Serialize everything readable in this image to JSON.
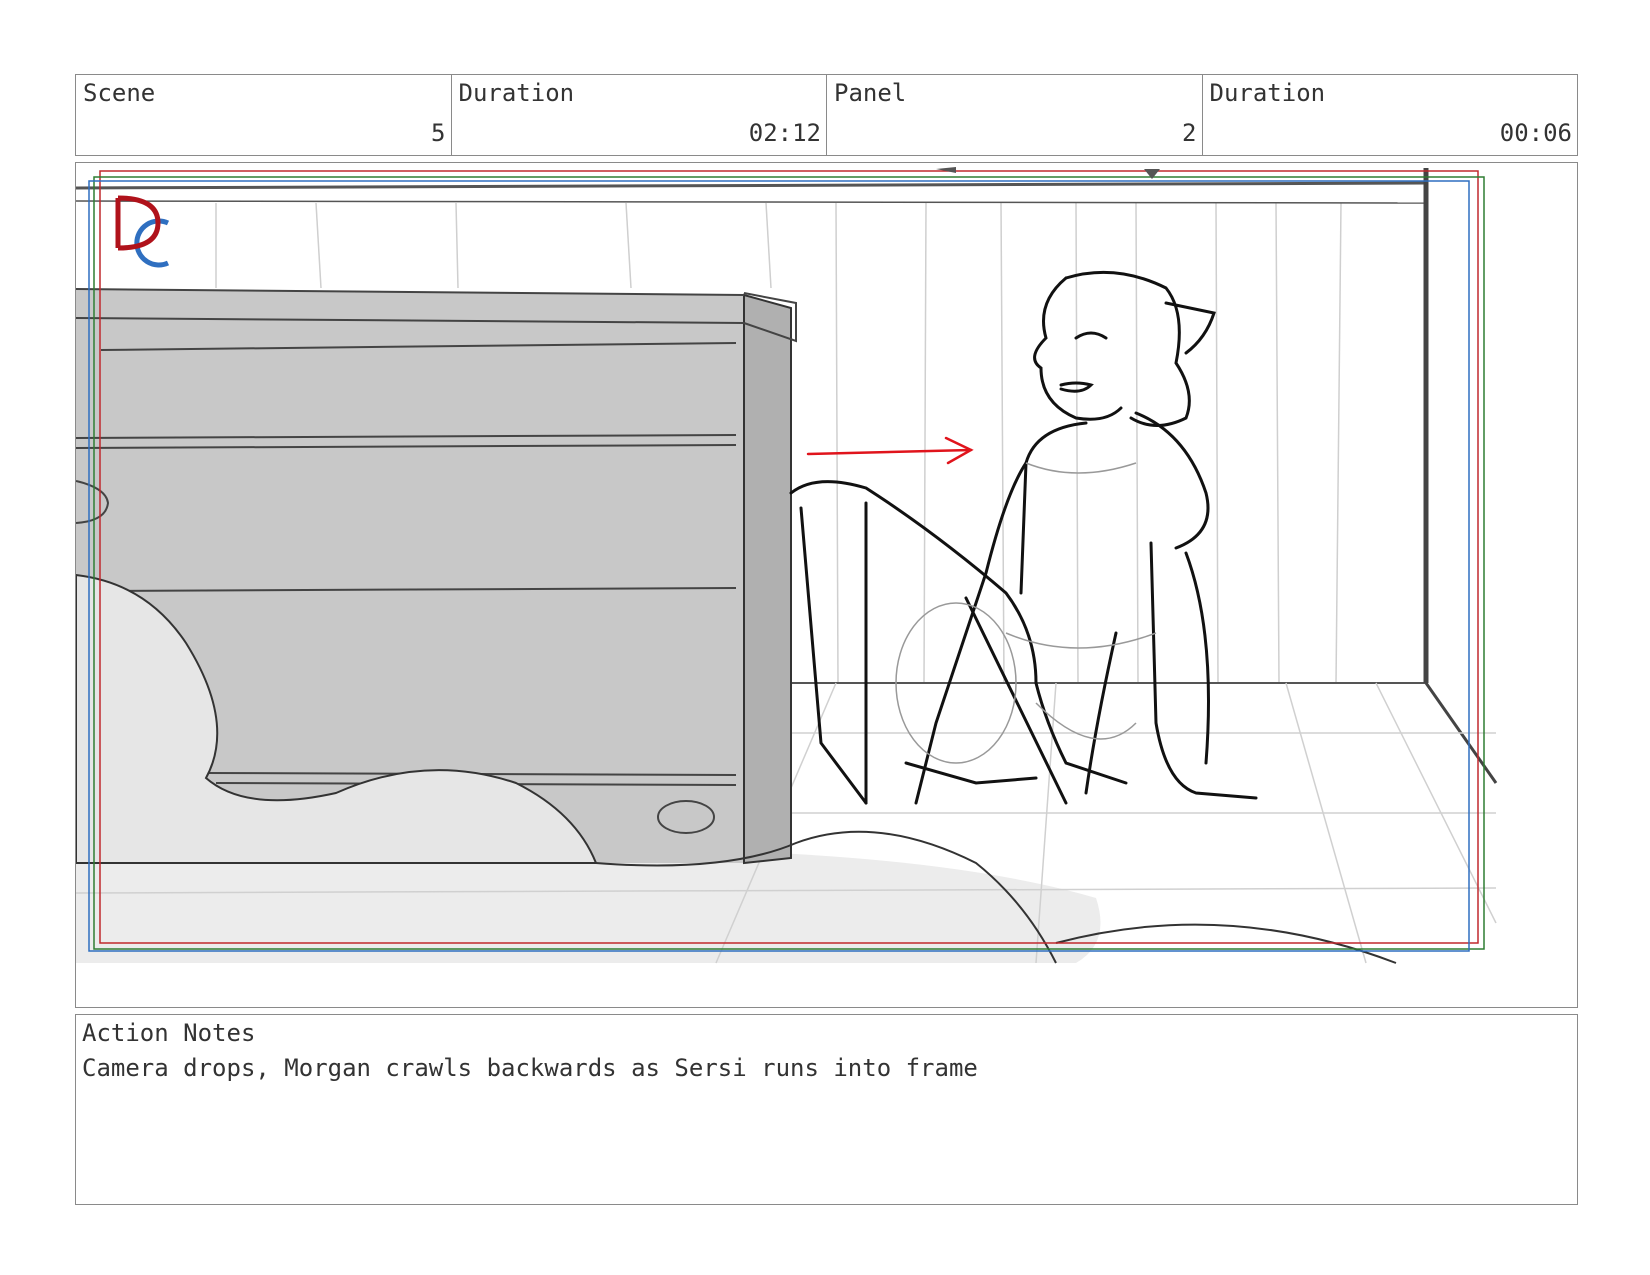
{
  "header": {
    "scene_label": "Scene",
    "scene_value": "5",
    "scene_duration_label": "Duration",
    "scene_duration_value": "02:12",
    "panel_label": "Panel",
    "panel_value": "2",
    "panel_duration_label": "Duration",
    "panel_duration_value": "00:06"
  },
  "panel": {
    "frame_colors": {
      "red": "#c0282d",
      "green": "#2e7d32",
      "blue": "#2f6fc0"
    },
    "arrow_color": "#e0141c"
  },
  "notes": {
    "title": "Action Notes",
    "text": "Camera drops, Morgan crawls backwards as Sersi runs into frame"
  }
}
